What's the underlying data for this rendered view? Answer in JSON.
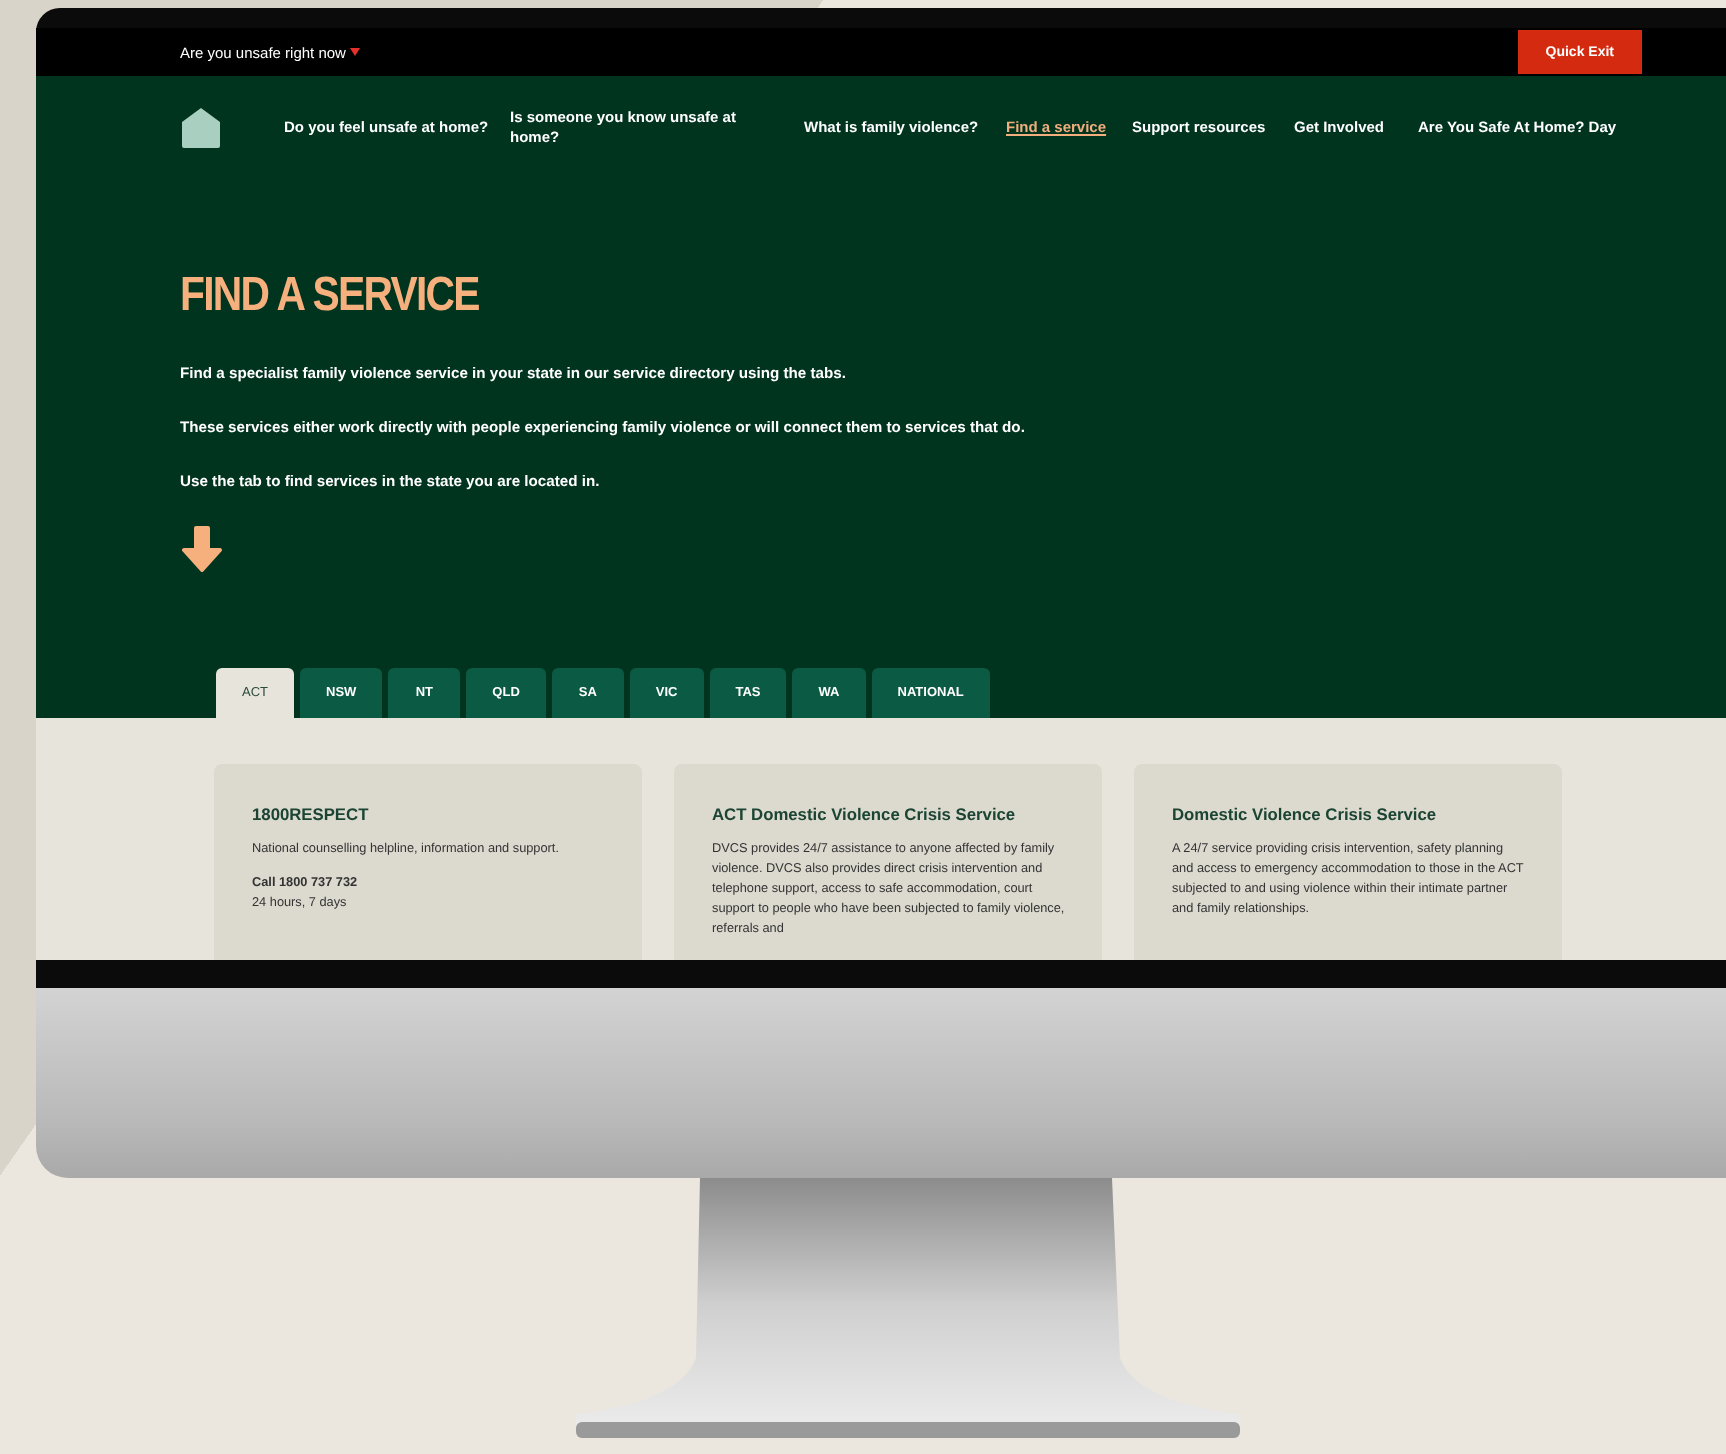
{
  "top_bar": {
    "alert_link": "Are you unsafe right now",
    "quick_exit": "Quick Exit"
  },
  "nav": {
    "items": [
      {
        "label": "Do you feel unsafe at home?",
        "selected": false
      },
      {
        "label": "Is someone you know unsafe at home?",
        "selected": false
      },
      {
        "label": "What is family violence?",
        "selected": false
      },
      {
        "label": "Find a service",
        "selected": true
      },
      {
        "label": "Support resources",
        "selected": false
      },
      {
        "label": "Get Involved",
        "selected": false
      },
      {
        "label": "Are You Safe At Home? Day",
        "selected": false
      }
    ]
  },
  "hero": {
    "title": "FIND A SERVICE",
    "paragraphs": [
      "Find a specialist family violence service in your state in our service directory using the tabs.",
      "These services either work directly with people experiencing family violence or will connect them to services that do.",
      "Use the tab to find services in the state you are located in."
    ]
  },
  "tabs": [
    {
      "label": "ACT",
      "selected": true
    },
    {
      "label": "NSW",
      "selected": false
    },
    {
      "label": "NT",
      "selected": false
    },
    {
      "label": "QLD",
      "selected": false
    },
    {
      "label": "SA",
      "selected": false
    },
    {
      "label": "VIC",
      "selected": false
    },
    {
      "label": "TAS",
      "selected": false
    },
    {
      "label": "WA",
      "selected": false
    },
    {
      "label": "NATIONAL",
      "selected": false
    }
  ],
  "cards": [
    {
      "title": "1800RESPECT",
      "paragraphs": [
        "National counselling helpline, information and support.",
        "**Call 1800 737 732**\n24 hours, 7 days"
      ]
    },
    {
      "title": "ACT Domestic Violence Crisis Service",
      "paragraphs": [
        "DVCS provides 24/7 assistance to anyone affected by family violence. DVCS also provides direct crisis intervention and telephone support, access to safe accommodation, court support to people who have been subjected to family violence, referrals and"
      ]
    },
    {
      "title": "Domestic Violence Crisis Service",
      "paragraphs": [
        "A 24/7 service providing crisis intervention, safety planning and access to emergency accommodation to those in the ACT subjected to and using violence within their intimate partner and family relationships."
      ]
    }
  ]
}
